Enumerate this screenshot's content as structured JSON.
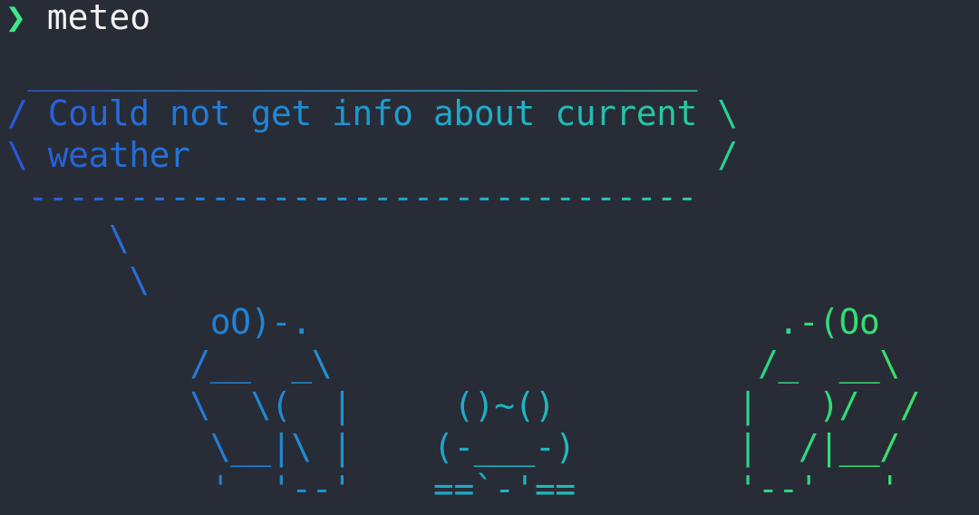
{
  "prompt": {
    "symbol": "❯",
    "command": "meteo"
  },
  "output": {
    "message_lines": [
      "Could not get info about current",
      "weather"
    ],
    "ascii_art": " _________________________________\n/ Could not get info about current \\\n\\ weather                          /\n ---------------------------------\n     \\\n      \\\n          oO)-.                       .-(Oo\n         /__  _\\                     /_  __\\\n         \\  \\(  |     ()~()         |   )/  /\n          \\__|\\ |    (-___-)        |  /|__/\n          '  '--'    ==`-'==        '--'   '"
  },
  "colors": {
    "background": "#282c36",
    "prompt_arrow": "#3ee88a",
    "command_text": "#f2f2f2",
    "gradient_start": "#2b57d8",
    "gradient_mid": "#1fb3c4",
    "gradient_end": "#3ee85a"
  }
}
